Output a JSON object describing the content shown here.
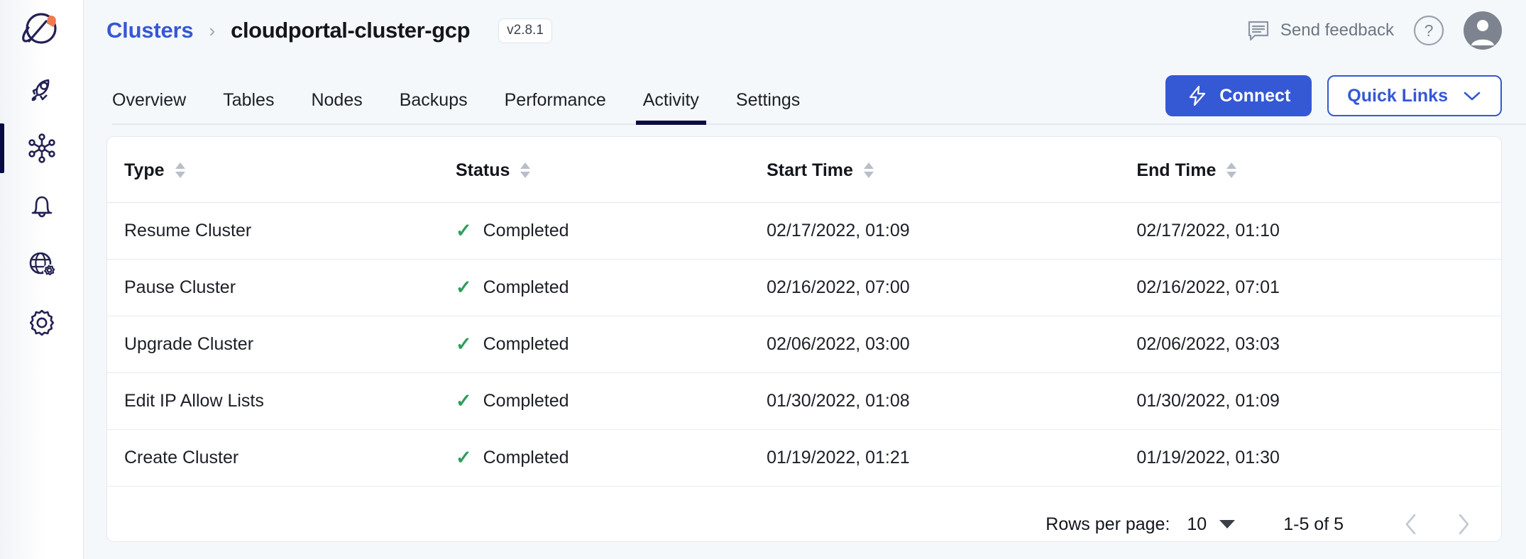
{
  "sidebar": {
    "logo": "planet-rocket-logo",
    "items": [
      {
        "name": "sidebar-item-getting-started",
        "icon": "rocket-icon",
        "active": false
      },
      {
        "name": "sidebar-item-clusters",
        "icon": "cluster-nodes-icon",
        "active": true
      },
      {
        "name": "sidebar-item-alerts",
        "icon": "bell-icon",
        "active": false
      },
      {
        "name": "sidebar-item-network",
        "icon": "globe-settings-icon",
        "active": false
      },
      {
        "name": "sidebar-item-settings",
        "icon": "gear-icon",
        "active": false
      }
    ]
  },
  "header": {
    "breadcrumb_parent": "Clusters",
    "breadcrumb_separator": "›",
    "breadcrumb_current": "cloudportal-cluster-gcp",
    "version_badge": "v2.8.1",
    "feedback_label": "Send feedback",
    "feedback_icon": "comment-icon",
    "help_icon": "question-circle-icon",
    "avatar_icon": "user-avatar-icon"
  },
  "tabs": [
    {
      "label": "Overview",
      "active": false
    },
    {
      "label": "Tables",
      "active": false
    },
    {
      "label": "Nodes",
      "active": false
    },
    {
      "label": "Backups",
      "active": false
    },
    {
      "label": "Performance",
      "active": false
    },
    {
      "label": "Activity",
      "active": true
    },
    {
      "label": "Settings",
      "active": false
    }
  ],
  "actions": {
    "connect_label": "Connect",
    "connect_icon": "lightning-bolt-icon",
    "quick_links_label": "Quick Links",
    "quick_links_icon": "chevron-down-icon"
  },
  "table": {
    "columns": [
      {
        "label": "Type",
        "sortable": true
      },
      {
        "label": "Status",
        "sortable": true
      },
      {
        "label": "Start Time",
        "sortable": true
      },
      {
        "label": "End Time",
        "sortable": true
      }
    ],
    "rows": [
      {
        "type": "Resume Cluster",
        "status": "Completed",
        "start": "02/17/2022, 01:09",
        "end": "02/17/2022, 01:10"
      },
      {
        "type": "Pause Cluster",
        "status": "Completed",
        "start": "02/16/2022, 07:00",
        "end": "02/16/2022, 07:01"
      },
      {
        "type": "Upgrade Cluster",
        "status": "Completed",
        "start": "02/06/2022, 03:00",
        "end": "02/06/2022, 03:03"
      },
      {
        "type": "Edit IP Allow Lists",
        "status": "Completed",
        "start": "01/30/2022, 01:08",
        "end": "01/30/2022, 01:09"
      },
      {
        "type": "Create Cluster",
        "status": "Completed",
        "start": "01/19/2022, 01:21",
        "end": "01/19/2022, 01:30"
      }
    ]
  },
  "pagination": {
    "rows_per_page_label": "Rows per page:",
    "rows_per_page_value": "10",
    "range_label": "1-5 of 5",
    "prev_icon": "chevron-left-icon",
    "next_icon": "chevron-right-icon"
  },
  "colors": {
    "accent_blue": "#3558d4",
    "navy": "#0b0b44",
    "success_green": "#2e9e5b",
    "page_bg": "#f5f8fb",
    "orange": "#ef7b4d"
  }
}
